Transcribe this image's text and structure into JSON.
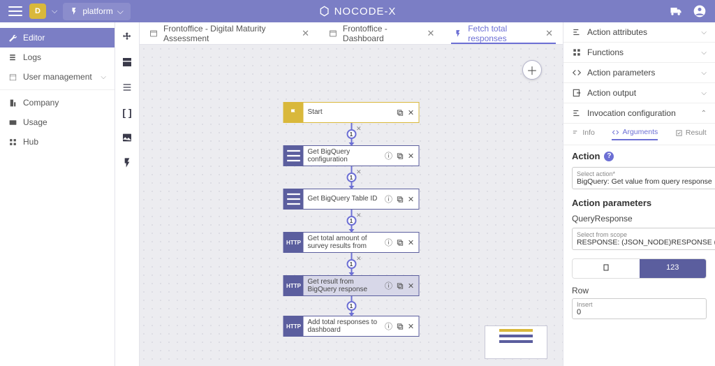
{
  "top": {
    "badge": "D",
    "platform": "platform",
    "brand": "NOCODE-X"
  },
  "nav": {
    "editor": "Editor",
    "logs": "Logs",
    "usermgmt": "User management",
    "company": "Company",
    "usage": "Usage",
    "hub": "Hub"
  },
  "tabs": [
    {
      "label": "Frontoffice - Digital Maturity Assessment"
    },
    {
      "label": "Frontoffice - Dashboard"
    },
    {
      "label": "Fetch total responses"
    }
  ],
  "flow": {
    "start": "Start",
    "n1": "Get BigQuery configuration",
    "n2": "Get BigQuery Table ID",
    "n3": "Get total amount of survey results from",
    "n4": "Get result from BigQuery response",
    "n5": "Add total responses to dashboard",
    "seq": "1"
  },
  "panel": {
    "acc": {
      "attrs": "Action attributes",
      "funcs": "Functions",
      "params": "Action parameters",
      "output": "Action output",
      "invoc": "Invocation configuration"
    },
    "subtabs": {
      "info": "Info",
      "args": "Arguments",
      "result": "Result"
    },
    "action_h": "Action",
    "sel_action_lab": "Select action*",
    "sel_action_val": "BigQuery: Get value from query response",
    "ap_h": "Action parameters",
    "qr_h": "QueryResponse",
    "scope_lab": "Select from scope",
    "scope_val": "RESPONSE: (JSON_NODE)RESPONSE (Body) ...",
    "toggle_123": "123",
    "row_h": "Row",
    "insert_lab": "Insert",
    "insert_val": "0"
  }
}
